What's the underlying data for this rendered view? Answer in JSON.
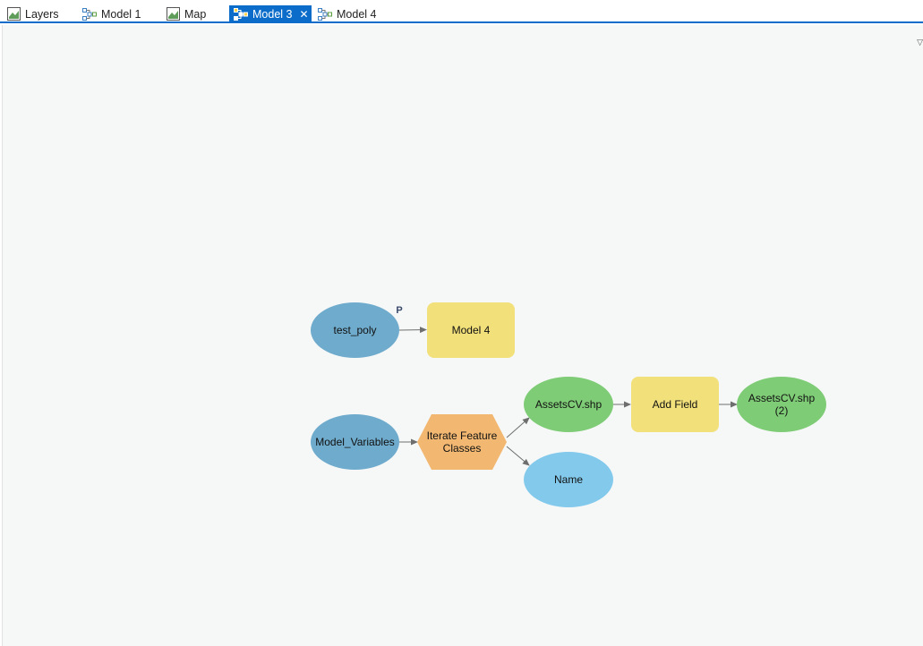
{
  "tabs": [
    {
      "label": "Layers",
      "icon": "map-icon",
      "active": false
    },
    {
      "label": "Model 1",
      "icon": "model-icon",
      "active": false
    },
    {
      "label": "Map",
      "icon": "map-icon",
      "active": false
    },
    {
      "label": "Model 3",
      "icon": "model-icon",
      "active": true
    },
    {
      "label": "Model 4",
      "icon": "model-icon",
      "active": false
    }
  ],
  "close_glyph": "✕",
  "colors": {
    "accent": "#0b6cc9",
    "canvas": "#f6f8f8",
    "variable_blue": "#6fabcc",
    "variable_light_blue": "#82c9ec",
    "tool_yellow": "#f2e07a",
    "data_green": "#7fcc76",
    "iterator_orange": "#f2b872",
    "arrow": "#6e6e6e"
  },
  "model": {
    "nodes": {
      "test_poly": {
        "label": "test_poly",
        "kind": "variable",
        "parameter_flag": "P"
      },
      "model4": {
        "label": "Model 4",
        "kind": "tool"
      },
      "model_variables": {
        "label": "Model_Variables",
        "kind": "variable"
      },
      "iterate": {
        "label_line1": "Iterate Feature",
        "label_line2": "Classes",
        "kind": "iterator"
      },
      "assets": {
        "label": "AssetsCV.shp",
        "kind": "derived-data"
      },
      "name": {
        "label": "Name",
        "kind": "inline-variable"
      },
      "add_field": {
        "label": "Add Field",
        "kind": "tool"
      },
      "assets2": {
        "label_line1": "AssetsCV.shp",
        "label_line2": "(2)",
        "kind": "derived-data"
      }
    }
  }
}
